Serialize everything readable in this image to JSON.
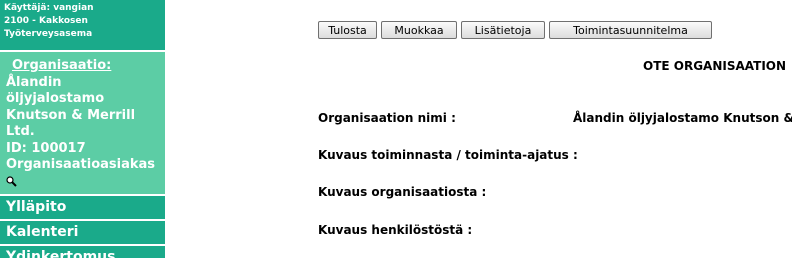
{
  "sidebar": {
    "user": {
      "line1": "Käyttäjä: vangian",
      "line2": "2100 - Kakkosen",
      "line3": "Työterveysasema"
    },
    "organization": {
      "heading": "Organisaatio:",
      "name_line1": "Ålandin",
      "name_line2": "öljyjalostamo",
      "name_line3": "Knutson & Merrill",
      "name_line4": "Ltd.",
      "id_line": "ID: 100017",
      "type_line": "Organisaatioasiakas",
      "search_icon": "magnifier-icon"
    },
    "nav": [
      {
        "label": "Ylläpito"
      },
      {
        "label": "Kalenteri"
      },
      {
        "label": "Ydinkertomus"
      }
    ]
  },
  "toolbar": {
    "print_label": "Tulosta",
    "edit_label": "Muokkaa",
    "info_label": "Lisätietoja",
    "plan_label": "Toimintasuunnitelma"
  },
  "document": {
    "title": "OTE ORGANISAATION",
    "fields": [
      {
        "label": "Organisaation nimi :",
        "value": "Ålandin öljyjalostamo Knutson &"
      },
      {
        "label": "Kuvaus toiminnasta / toiminta-ajatus :",
        "value": ""
      },
      {
        "label": "Kuvaus organisaatiosta :",
        "value": ""
      },
      {
        "label": "Kuvaus henkilöstöstä :",
        "value": ""
      }
    ]
  },
  "colors": {
    "sidebar_dark": "#1aaa8a",
    "sidebar_light": "#5ccda5"
  }
}
